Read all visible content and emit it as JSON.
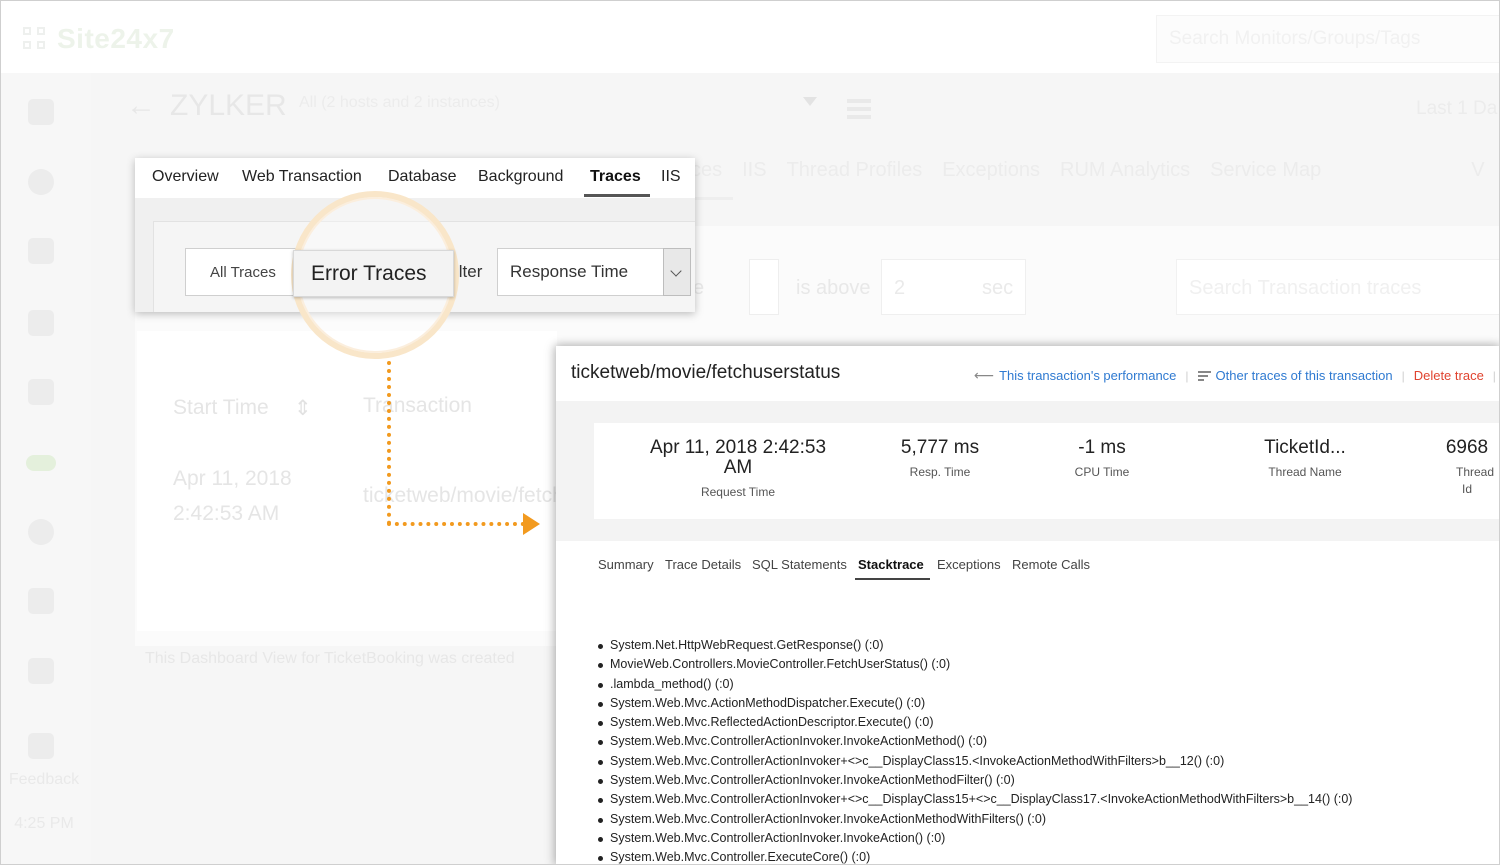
{
  "app": {
    "brand": "Site24x7",
    "search_placeholder": "Search Monitors/Groups/Tags",
    "feedback_label": "Feedback",
    "clock": "4:25 PM"
  },
  "header": {
    "title": "ZYLKER",
    "subtitle": "All (2 hosts and 2 instances)",
    "date_range": "Last 1 Da"
  },
  "bg_tabs": [
    "ces",
    "IIS",
    "Thread Profiles",
    "Exceptions",
    "RUM Analytics",
    "Service Map",
    "V"
  ],
  "bg_filter": {
    "above_label": "is above",
    "value": "2",
    "unit": "sec",
    "search_placeholder": "Search Transaction traces",
    "partial_label": "e"
  },
  "bg_table": {
    "col_start": "Start Time",
    "col_transaction": "Transaction",
    "row_date": "Apr 11, 2018",
    "row_time": "2:42:53 AM",
    "row_transaction": "ticketweb/movie/fetch"
  },
  "bg_footer": "This Dashboard View for TicketBooking  was created",
  "zoom": {
    "tabs": [
      "Overview",
      "Web Transaction",
      "Database",
      "Background",
      "Traces",
      "IIS"
    ],
    "active_tab": "Traces",
    "all_traces": "All Traces",
    "error_traces": "Error Traces",
    "filter_partial": "ilter",
    "sort_by": "Response Time"
  },
  "detail": {
    "title": "ticketweb/movie/fetchuserstatus",
    "actions": {
      "performance": "This transaction's performance",
      "other_traces": "Other traces of this transaction",
      "delete": "Delete trace"
    },
    "stats": [
      {
        "value": "Apr 11, 2018 2:42:53 AM",
        "label": "Request Time"
      },
      {
        "value": "5,777 ms",
        "label": "Resp. Time"
      },
      {
        "value": "-1 ms",
        "label": "CPU Time"
      },
      {
        "value": "TicketId...",
        "label": "Thread Name"
      },
      {
        "value": "6968",
        "label": "Thread Id"
      }
    ],
    "tabs": [
      "Summary",
      "Trace Details",
      "SQL Statements",
      "Stacktrace",
      "Exceptions",
      "Remote Calls"
    ],
    "active_tab": "Stacktrace",
    "stacktrace": [
      "System.Net.HttpWebRequest.GetResponse() (:0)",
      "MovieWeb.Controllers.MovieController.FetchUserStatus() (:0)",
      ".lambda_method() (:0)",
      "System.Web.Mvc.ActionMethodDispatcher.Execute() (:0)",
      "System.Web.Mvc.ReflectedActionDescriptor.Execute() (:0)",
      "System.Web.Mvc.ControllerActionInvoker.InvokeActionMethod() (:0)",
      "System.Web.Mvc.ControllerActionInvoker+<>c__DisplayClass15.<InvokeActionMethodWithFilters>b__12() (:0)",
      "System.Web.Mvc.ControllerActionInvoker.InvokeActionMethodFilter() (:0)",
      "System.Web.Mvc.ControllerActionInvoker+<>c__DisplayClass15+<>c__DisplayClass17.<InvokeActionMethodWithFilters>b__14() (:0)",
      "System.Web.Mvc.ControllerActionInvoker.InvokeActionMethodWithFilters() (:0)",
      "System.Web.Mvc.ControllerActionInvoker.InvokeAction() (:0)",
      "System.Web.Mvc.Controller.ExecuteCore() (:0)"
    ]
  },
  "colors": {
    "accent_orange": "#f29a1f",
    "link_blue": "#2f7ad1",
    "delete_red": "#e0432f"
  }
}
